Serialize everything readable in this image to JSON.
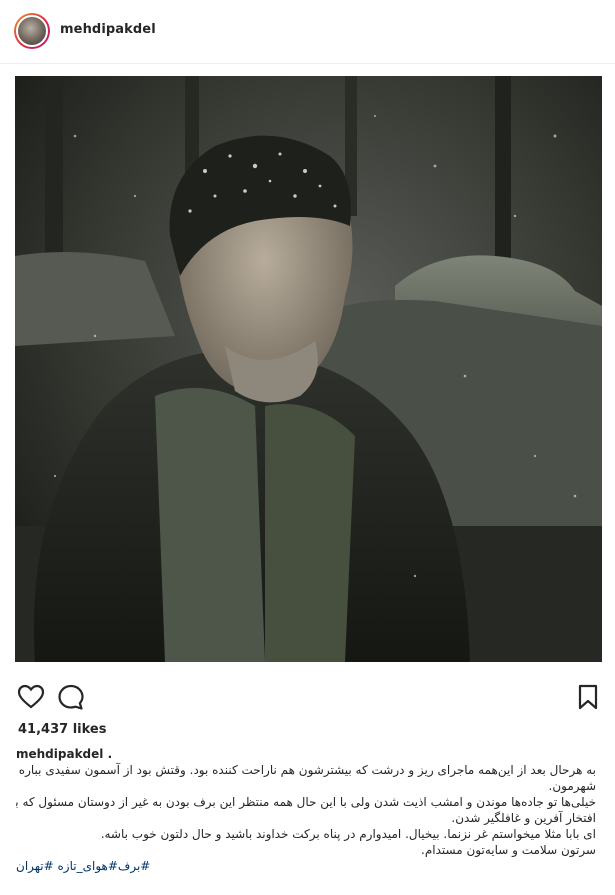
{
  "header": {
    "username": "mehdipakdel"
  },
  "post": {
    "likes": "41,437 likes",
    "caption_user": "mehdipakdel .",
    "caption_lines": [
      "به هرحال بعد از این‌همه ماجرای ریز و درشت که بیشترشون هم ناراحت کننده بود. وقتش بود از آسمون سفیدی بباره رو",
      "شهرمون.",
      "خیلی‌ها تو جاده‌ها موندن و امشب اذیت شدن ولی با این حال همه منتظر این برف بودن به غیر از دوستان مسئول که باز هم",
      "افتخار آفرین و غافلگیر شدن.",
      "ای بابا مثلا میخواستم غر نزنما. بیخیال. امیدوارم در پناه برکت خداوند باشید و حال دلتون خوب باشه.",
      "سرتون سلامت و سایه‌تون مستدام."
    ],
    "hashtags": "برف#هوای_تازه #تهران#"
  },
  "icons": {
    "like": "heart-outline-icon",
    "comment": "comment-bubble-icon",
    "save": "bookmark-icon"
  },
  "colors": {
    "text": "#262626",
    "hashtag": "#003569",
    "avatar_ring_start": "#f09433",
    "avatar_ring_end": "#bc1888"
  }
}
